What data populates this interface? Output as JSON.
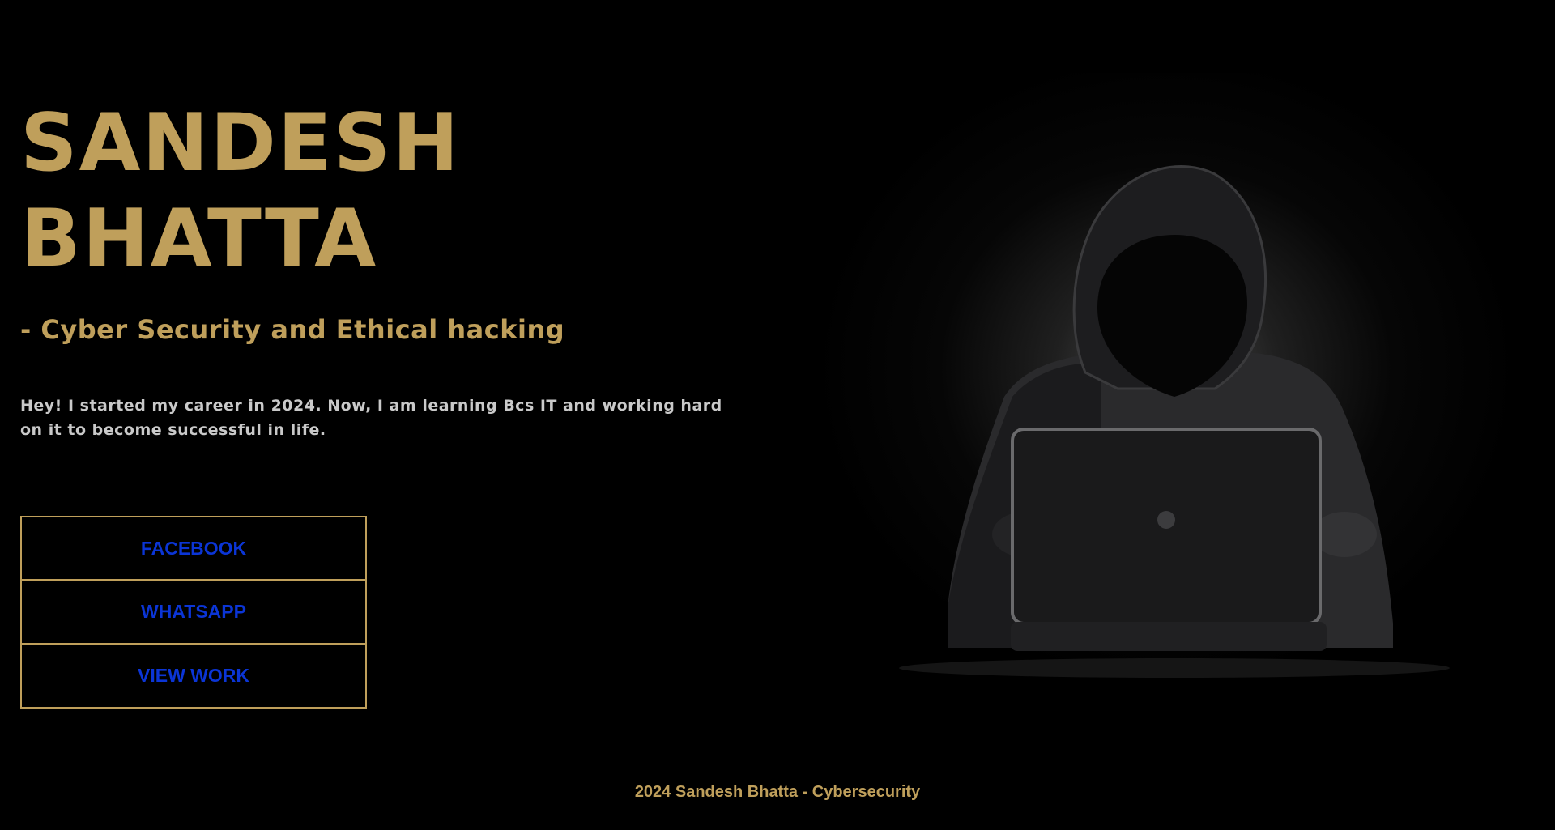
{
  "hero": {
    "name_line1": "SANDESH",
    "name_line2": "BHATTA",
    "tagline": "- Cyber Security and Ethical hacking",
    "intro": "Hey! I started my career in 2024. Now, I am learning Bcs IT and working hard on it to become successful in life."
  },
  "links": {
    "facebook_label": "FACEBOOK",
    "whatsapp_label": "WHATSAPP",
    "view_work_label": "VIEW WORK"
  },
  "illustration": {
    "icon": "hooded-hacker-with-laptop"
  },
  "footer": {
    "text": "2024 Sandesh Bhatta - Cybersecurity"
  },
  "colors": {
    "background": "#000000",
    "accent_gold": "#bf9f5b",
    "link_blue": "#0b35d6",
    "body_text": "#c9c9c9"
  }
}
